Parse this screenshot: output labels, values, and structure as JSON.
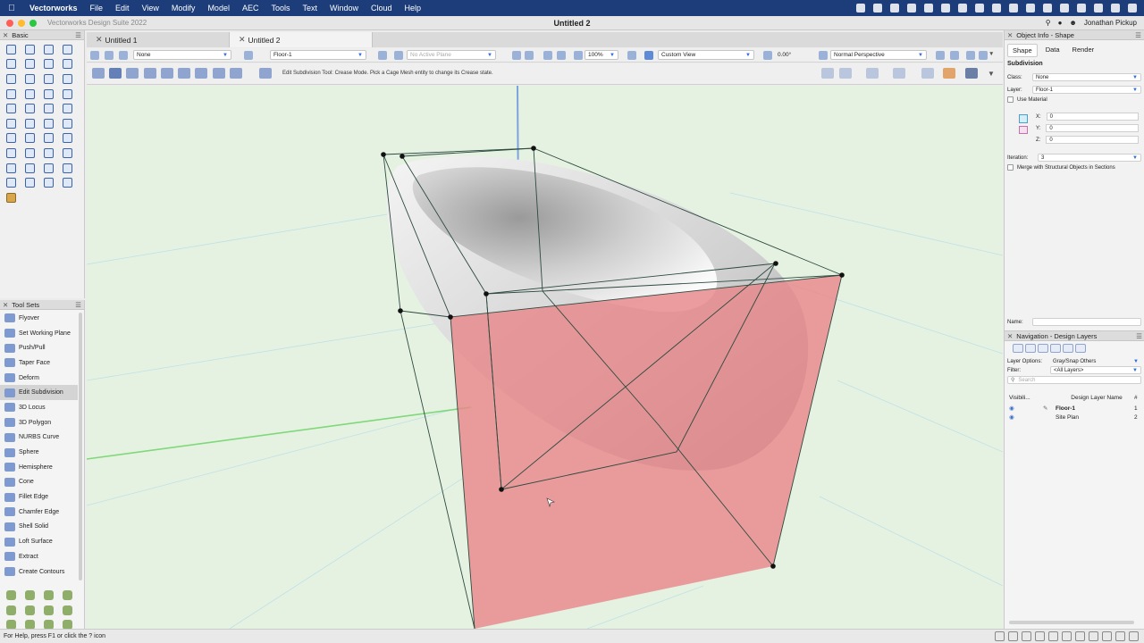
{
  "menubar": {
    "app": "Vectorworks",
    "items": [
      "File",
      "Edit",
      "View",
      "Modify",
      "Model",
      "AEC",
      "Tools",
      "Text",
      "Window",
      "Cloud",
      "Help"
    ]
  },
  "window": {
    "suite": "Vectorworks Design Suite 2022",
    "doc_title": "Untitled 2",
    "user": "Jonathan Pickup"
  },
  "tabs": [
    {
      "label": "Untitled 1",
      "active": false
    },
    {
      "label": "Untitled 2",
      "active": true
    }
  ],
  "basic_palette": {
    "title": "Basic",
    "tool_icons": [
      "selection-icon",
      "pan-icon",
      "flyover-icon",
      "zoom-icon",
      "text-icon",
      "callout-icon",
      "symbol-insertion-icon",
      "visualization-icon",
      "line-icon",
      "double-line-icon",
      "rectangle-icon",
      "rounded-rect-icon",
      "circle-icon",
      "oval-icon",
      "arc-icon",
      "freehand-icon",
      "polygon-icon",
      "polyline-icon",
      "double-polyline-icon",
      "spiral-icon",
      "target-icon",
      "eyedropper-icon",
      "attribute-icon",
      "mirror-icon",
      "move-icon",
      "rotate-icon",
      "offset-icon",
      "reshape-icon",
      "clip-icon",
      "fillet-icon",
      "chamfer-icon",
      "connect-icon",
      "dimension-icon",
      "trim-icon",
      "split-icon",
      "join-icon",
      "tape-icon",
      "protractor-icon",
      "locus-icon",
      "grid-icon",
      "hand-icon"
    ]
  },
  "toolsets": {
    "title": "Tool Sets",
    "items": [
      {
        "label": "Flyover",
        "icon": "flyover-icon"
      },
      {
        "label": "Set Working Plane",
        "icon": "working-plane-icon"
      },
      {
        "label": "Push/Pull",
        "icon": "push-pull-icon"
      },
      {
        "label": "Taper Face",
        "icon": "taper-face-icon"
      },
      {
        "label": "Deform",
        "icon": "deform-icon"
      },
      {
        "label": "Edit Subdivision",
        "icon": "edit-subdivision-icon",
        "active": true
      },
      {
        "label": "3D Locus",
        "icon": "locus-3d-icon"
      },
      {
        "label": "3D Polygon",
        "icon": "polygon-3d-icon"
      },
      {
        "label": "NURBS Curve",
        "icon": "nurbs-curve-icon"
      },
      {
        "label": "Sphere",
        "icon": "sphere-icon"
      },
      {
        "label": "Hemisphere",
        "icon": "hemisphere-icon"
      },
      {
        "label": "Cone",
        "icon": "cone-icon"
      },
      {
        "label": "Fillet Edge",
        "icon": "fillet-edge-icon"
      },
      {
        "label": "Chamfer Edge",
        "icon": "chamfer-edge-icon"
      },
      {
        "label": "Shell Solid",
        "icon": "shell-solid-icon"
      },
      {
        "label": "Loft Surface",
        "icon": "loft-surface-icon"
      },
      {
        "label": "Extract",
        "icon": "extract-icon"
      },
      {
        "label": "Create Contours",
        "icon": "create-contours-icon"
      }
    ],
    "category_icons": [
      "site-planning-icon",
      "3d-modeling-icon",
      "building-shell-icon",
      "furniture-icon",
      "visualization-icon",
      "annotation-icon",
      "detailing-icon",
      "landscape-icon",
      "dims-icon",
      "site-icon",
      "fixtures-icon",
      "machine-icon"
    ]
  },
  "viewbar": {
    "class": "None",
    "layer": "Floor-1",
    "plane": "No Active Plane",
    "zoom": "100%",
    "view": "Custom View",
    "rotation": "0.00°",
    "projection": "Normal Perspective"
  },
  "modebar": {
    "message": "Edit Subdivision Tool: Crease Mode. Pick a Cage Mesh entity to change its Crease state."
  },
  "object_info": {
    "title": "Object Info - Shape",
    "tabs": [
      "Shape",
      "Data",
      "Render"
    ],
    "object_type": "Subdivision",
    "class_label": "Class:",
    "class_value": "None",
    "layer_label": "Layer:",
    "layer_value": "Floor-1",
    "use_material": "Use Material",
    "x_label": "X:",
    "x_value": "0",
    "y_label": "Y:",
    "y_value": "0",
    "z_label": "Z:",
    "z_value": "0",
    "iteration_label": "Iteration:",
    "iteration_value": "3",
    "merge_label": "Merge with Structural Objects in Sections",
    "name_label": "Name:"
  },
  "navigation": {
    "title": "Navigation - Design Layers",
    "layer_options_label": "Layer Options:",
    "layer_options_value": "Gray/Snap Others",
    "filter_label": "Filter:",
    "filter_value": "<All Layers>",
    "search_placeholder": "Search",
    "col_visibility": "Visibili...",
    "col_name": "Design Layer Name",
    "col_num": "#",
    "layers": [
      {
        "name": "Floor-1",
        "num": "1",
        "active": true
      },
      {
        "name": "Site Plan",
        "num": "2",
        "active": false
      }
    ]
  },
  "status": {
    "help": "For Help, press F1 or click the ? icon"
  },
  "colors": {
    "menubar": "#1c3d7a",
    "viewport_bg": "#e5f2e1",
    "face_highlight": "#e8878a",
    "accent": "#2d6fd6"
  }
}
